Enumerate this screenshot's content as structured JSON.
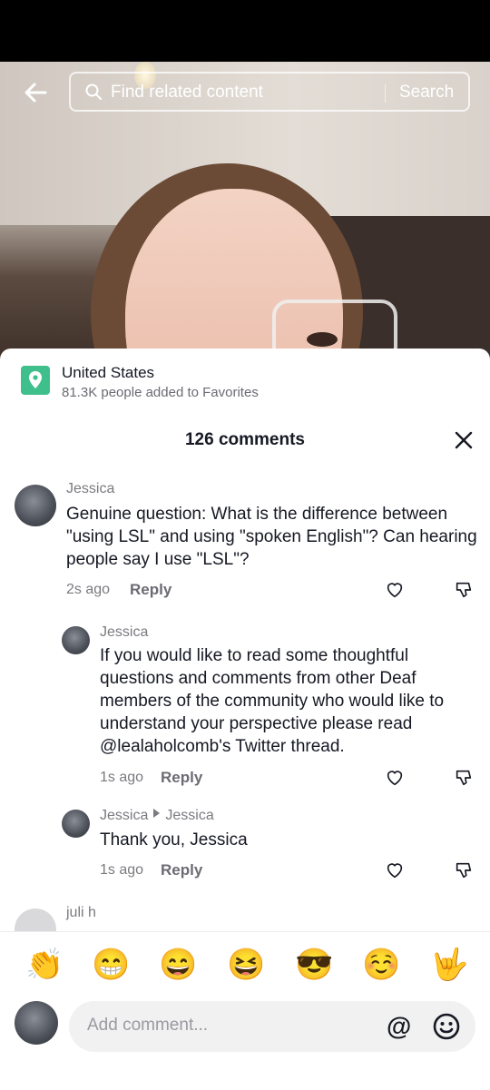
{
  "search": {
    "placeholder": "Find related content",
    "button": "Search"
  },
  "location": {
    "title": "United States",
    "subtitle": "81.3K people added to Favorites"
  },
  "comments_header": {
    "count_label": "126 comments"
  },
  "comments": [
    {
      "name": "Jessica",
      "text": "Genuine question: What is the difference between \"using LSL\" and using \"spoken English\"? Can hearing people say I use \"LSL\"?",
      "time": "2s ago",
      "reply": "Reply"
    },
    {
      "name": "Jessica",
      "text": "If you would like to read some thoughtful questions and comments from other Deaf members of the community who would like to understand your perspective please read @lealaholcomb's Twitter thread.",
      "time": "1s ago",
      "reply": "Reply"
    },
    {
      "name": "Jessica",
      "reply_to": "Jessica",
      "text": "Thank you, Jessica",
      "time": "1s ago",
      "reply": "Reply"
    },
    {
      "name": "juli h"
    }
  ],
  "emoji_bar": [
    "👏",
    "😁",
    "😄",
    "😆",
    "😎",
    "☺️",
    "🤟"
  ],
  "composer": {
    "placeholder": "Add comment..."
  },
  "colors": {
    "location_pin": "#3fbf8b",
    "text_primary": "#161823",
    "text_secondary": "#7a7a80"
  }
}
